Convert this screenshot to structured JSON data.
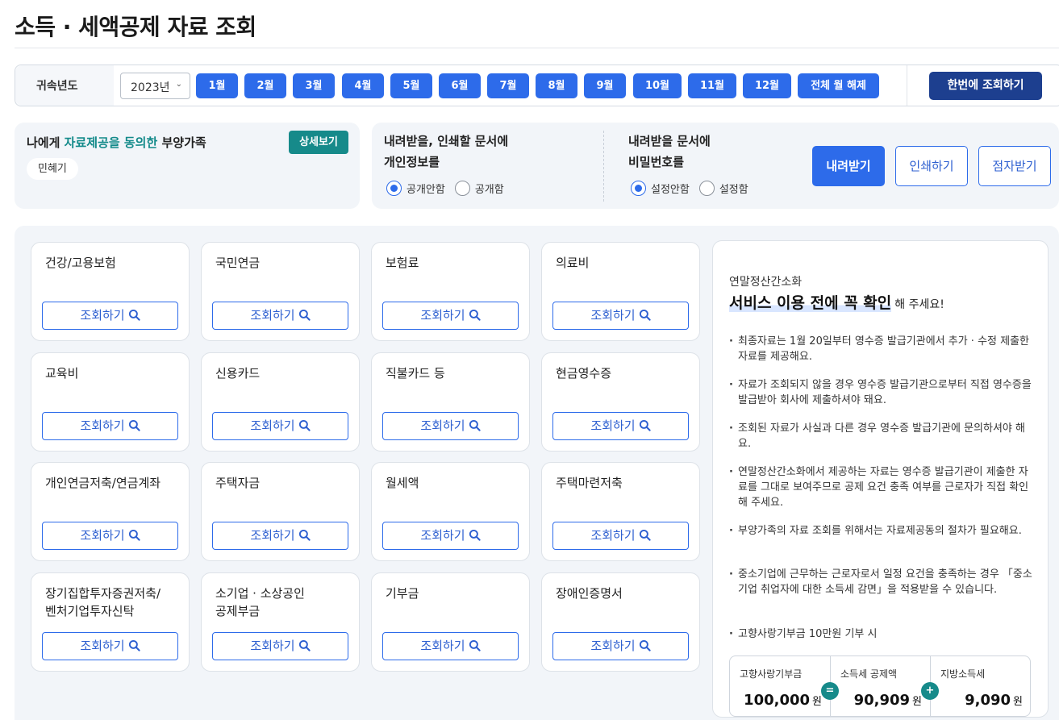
{
  "page": {
    "title": "소득 · 세액공제 자료 조회"
  },
  "year_bar": {
    "label": "귀속년도",
    "year_value": "2023년",
    "months": [
      "1월",
      "2월",
      "3월",
      "4월",
      "5월",
      "6월",
      "7월",
      "8월",
      "9월",
      "10월",
      "11월",
      "12월"
    ],
    "deselect_all": "전체 월 해제",
    "query_all": "한번에 조회하기"
  },
  "dependents": {
    "title_prefix": "나에게 ",
    "title_highlight": "자료제공을 동의한",
    "title_suffix": " 부양가족",
    "detail_button": "상세보기",
    "names": [
      "민혜기"
    ]
  },
  "download_options": {
    "personal_info": {
      "title_line1": "내려받을, 인쇄할 문서에",
      "title_line2": "개인정보를",
      "options": [
        "공개안함",
        "공개함"
      ],
      "selected": "공개안함"
    },
    "password": {
      "title_line1": "내려받을 문서에",
      "title_line2": "비밀번호를",
      "options": [
        "설정안함",
        "설정함"
      ],
      "selected": "설정안함"
    },
    "buttons": {
      "download": "내려받기",
      "print": "인쇄하기",
      "braille": "점자받기"
    }
  },
  "categories": {
    "button_label": "조회하기",
    "items": [
      "건강/고용보험",
      "국민연금",
      "보험료",
      "의료비",
      "교육비",
      "신용카드",
      "직불카드 등",
      "현금영수증",
      "개인연금저축/연금계좌",
      "주택자금",
      "월세액",
      "주택마련저축",
      "장기집합투자증권저축/\n벤처기업투자신탁",
      "소기업 · 소상공인\n공제부금",
      "기부금",
      "장애인증명서"
    ]
  },
  "info": {
    "kicker": "연말정산간소화",
    "headline": "서비스 이용 전에 꼭 확인",
    "headline_suffix": "해 주세요!",
    "bullets": [
      "최종자료는 1월 20일부터 영수증 발급기관에서 추가 · 수정 제출한 자료를 제공해요.",
      "자료가 조회되지 않을 경우 영수증 발급기관으로부터 직접 영수증을 발급받아 회사에 제출하셔야 돼요.",
      "조회된 자료가 사실과 다른 경우 영수증 발급기관에 문의하셔야 해요.",
      "연말정산간소화에서 제공하는 자료는 영수증 발급기관이 제출한 자료를 그대로 보여주므로 공제 요건 충족 여부를 근로자가 직접 확인해 주세요.",
      "부양가족의 자료 조회를 위해서는 자료제공동의 절차가 필요해요.",
      "중소기업에 근무하는 근로자로서 일정 요건을 충족하는 경우 「중소기업 취업자에 대한 소득세 감면」을 적용받을 수 있습니다.",
      "고향사랑기부금 10만원 기부 시"
    ],
    "calc": {
      "col1": {
        "label": "고향사랑기부금",
        "value": "100,000",
        "unit": "원"
      },
      "op1": "=",
      "col2": {
        "label": "소득세 공제액",
        "value": "90,909",
        "unit": "원"
      },
      "op2": "+",
      "col3": {
        "label": "지방소득세",
        "value": "9,090",
        "unit": "원"
      }
    }
  },
  "colors": {
    "primary": "#2d6bea",
    "navy": "#1d3f8f",
    "teal": "#168a8a",
    "panel_bg": "#f2f5f9"
  }
}
